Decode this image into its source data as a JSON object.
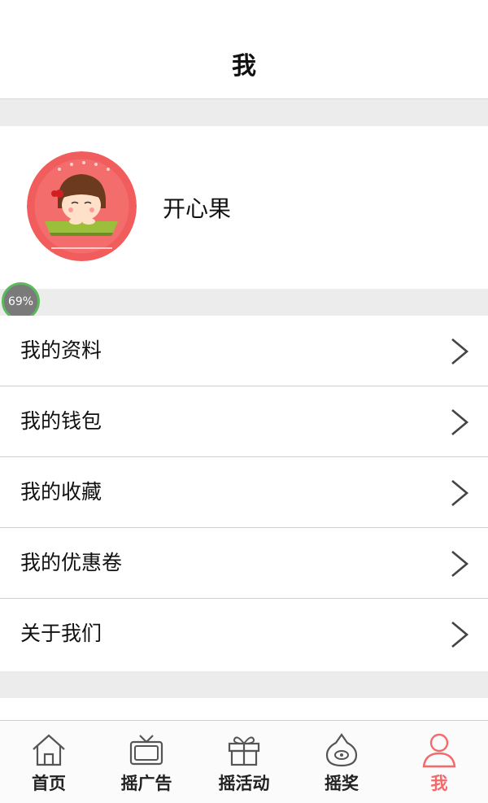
{
  "header": {
    "title": "我"
  },
  "profile": {
    "username": "开心果"
  },
  "progress_badge": {
    "label": "69%",
    "value": 69
  },
  "menu": {
    "items": [
      {
        "label": "我的资料"
      },
      {
        "label": "我的钱包"
      },
      {
        "label": "我的收藏"
      },
      {
        "label": "我的优惠卷"
      },
      {
        "label": "关于我们"
      }
    ]
  },
  "tabbar": {
    "tabs": [
      {
        "label": "首页",
        "icon": "home-icon"
      },
      {
        "label": "摇广告",
        "icon": "tv-icon"
      },
      {
        "label": "摇活动",
        "icon": "gift-icon"
      },
      {
        "label": "摇奖",
        "icon": "prize-icon"
      },
      {
        "label": "我",
        "icon": "user-icon",
        "active": true
      }
    ],
    "active_color": "#f26a6a",
    "inactive_color": "#222222"
  }
}
